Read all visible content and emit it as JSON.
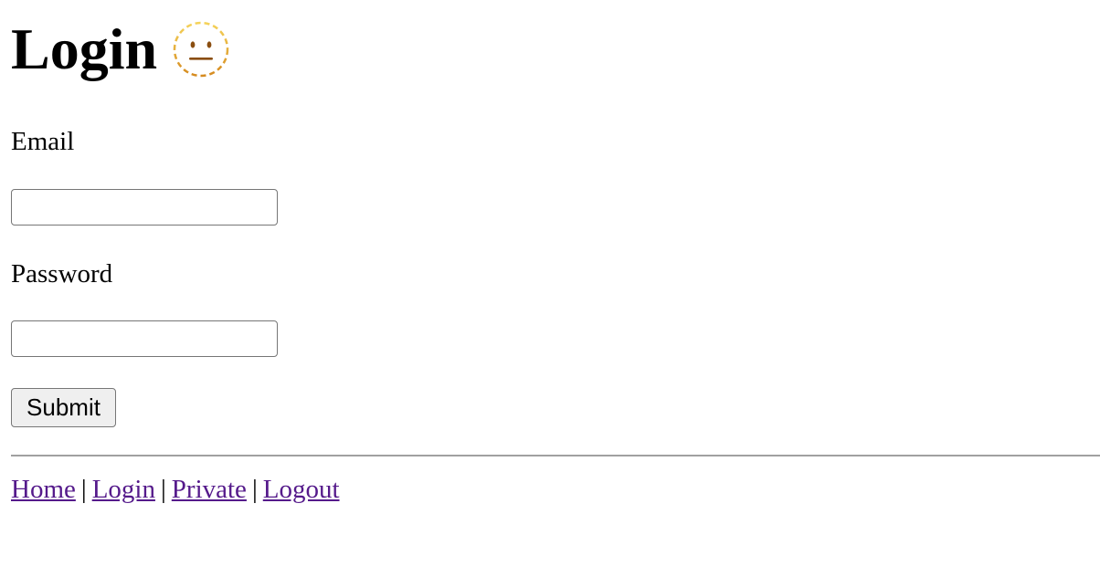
{
  "header": {
    "title": "Login",
    "emoji": "neutral-face-icon"
  },
  "form": {
    "email_label": "Email",
    "email_value": "",
    "password_label": "Password",
    "password_value": "",
    "submit_label": "Submit"
  },
  "nav": {
    "links": [
      {
        "label": "Home"
      },
      {
        "label": "Login"
      },
      {
        "label": "Private"
      },
      {
        "label": "Logout"
      }
    ],
    "separator": "|"
  },
  "colors": {
    "link_visited": "#551a8b",
    "button_bg": "#efefef",
    "input_border": "#767676",
    "divider": "#a0a0a0",
    "emoji_dash": "#e6b12e"
  }
}
